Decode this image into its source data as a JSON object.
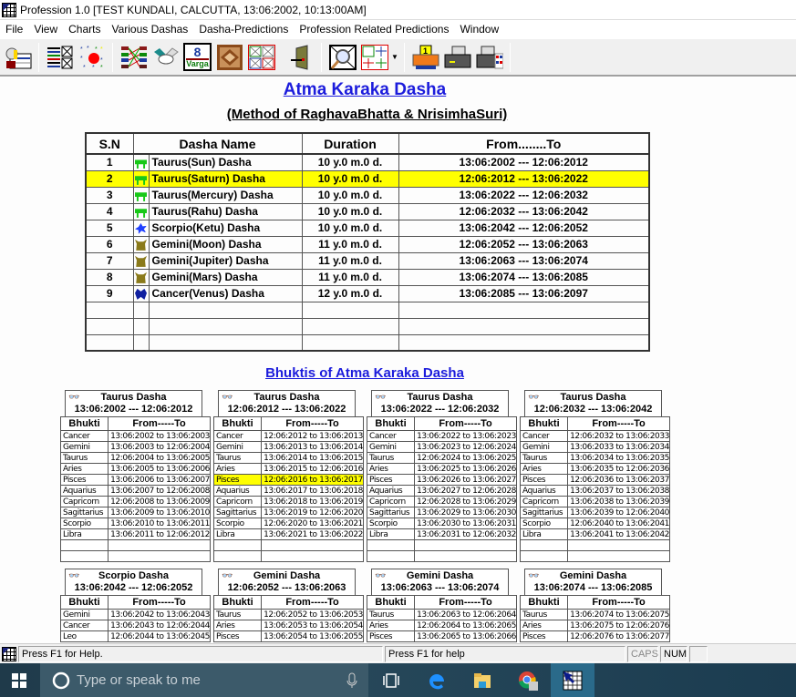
{
  "window": {
    "title": "Profession 1.0 [TEST KUNDALI, CALCUTTA, 13:06:2002, 10:13:00AM]"
  },
  "menu": [
    "File",
    "View",
    "Charts",
    "Various Dashas",
    "Dasha-Predictions",
    "Profession Related Predictions",
    "Window"
  ],
  "toolbar": {
    "buttons": [
      "person-card-icon",
      "chart-list-icon",
      "stars-planet-icon",
      "dasha-lines-icon",
      "handshake-icon",
      "varga-icon",
      "square-chart-icon",
      "four-charts-icon",
      "exit-door-icon",
      "magnify-chart-icon",
      "multi-chart-icon",
      "print-one-icon",
      "printer-icon",
      "color-printer-icon"
    ],
    "varga_number": "8",
    "varga_label": "Varga",
    "print_badge": "1"
  },
  "main": {
    "title": "Atma Karaka Dasha",
    "subtitle": "(Method of RaghavaBhatta & NrisimhaSuri)",
    "columns": [
      "S.N",
      "Dasha Name",
      "Duration",
      "From........To"
    ],
    "rows": [
      {
        "sn": "1",
        "sign": "taurus",
        "name": "Taurus(Sun) Dasha",
        "duration": "10 y.0 m.0 d.",
        "period": "13:06:2002 --- 12:06:2012",
        "highlight": false
      },
      {
        "sn": "2",
        "sign": "taurus",
        "name": "Taurus(Saturn) Dasha",
        "duration": "10 y.0 m.0 d.",
        "period": "12:06:2012 --- 13:06:2022",
        "highlight": true
      },
      {
        "sn": "3",
        "sign": "taurus",
        "name": "Taurus(Mercury) Dasha",
        "duration": "10 y.0 m.0 d.",
        "period": "13:06:2022 --- 12:06:2032",
        "highlight": false
      },
      {
        "sn": "4",
        "sign": "taurus",
        "name": "Taurus(Rahu) Dasha",
        "duration": "10 y.0 m.0 d.",
        "period": "12:06:2032 --- 13:06:2042",
        "highlight": false
      },
      {
        "sn": "5",
        "sign": "scorpio",
        "name": "Scorpio(Ketu) Dasha",
        "duration": "10 y.0 m.0 d.",
        "period": "13:06:2042 --- 12:06:2052",
        "highlight": false
      },
      {
        "sn": "6",
        "sign": "gemini",
        "name": "Gemini(Moon) Dasha",
        "duration": "11 y.0 m.0 d.",
        "period": "12:06:2052 --- 13:06:2063",
        "highlight": false
      },
      {
        "sn": "7",
        "sign": "gemini",
        "name": "Gemini(Jupiter) Dasha",
        "duration": "11 y.0 m.0 d.",
        "period": "13:06:2063 --- 13:06:2074",
        "highlight": false
      },
      {
        "sn": "8",
        "sign": "gemini",
        "name": "Gemini(Mars) Dasha",
        "duration": "11 y.0 m.0 d.",
        "period": "13:06:2074 --- 13:06:2085",
        "highlight": false
      },
      {
        "sn": "9",
        "sign": "cancer",
        "name": "Cancer(Venus) Dasha",
        "duration": "12 y.0 m.0 d.",
        "period": "13:06:2085 --- 13:06:2097",
        "highlight": false
      }
    ],
    "empty_rows": 3
  },
  "bhuktis": {
    "title": "Bhuktis of Atma Karaka Dasha",
    "col_bhukti": "Bhukti",
    "col_period": "From-----To",
    "blocks": [
      {
        "name": "Taurus Dasha",
        "period": "13:06:2002 --- 12:06:2012",
        "rows": [
          [
            "Cancer",
            "13:06:2002 to 13:06:2003"
          ],
          [
            "Gemini",
            "13:06:2003 to 12:06:2004"
          ],
          [
            "Taurus",
            "12:06:2004 to 13:06:2005"
          ],
          [
            "Aries",
            "13:06:2005 to 13:06:2006"
          ],
          [
            "Pisces",
            "13:06:2006 to 13:06:2007"
          ],
          [
            "Aquarius",
            "13:06:2007 to 12:06:2008"
          ],
          [
            "Capricorn",
            "12:06:2008 to 13:06:2009"
          ],
          [
            "Sagittarius",
            "13:06:2009 to 13:06:2010"
          ],
          [
            "Scorpio",
            "13:06:2010 to 13:06:2011"
          ],
          [
            "Libra",
            "13:06:2011 to 12:06:2012"
          ]
        ],
        "highlight": -1
      },
      {
        "name": "Taurus Dasha",
        "period": "12:06:2012 --- 13:06:2022",
        "rows": [
          [
            "Cancer",
            "12:06:2012 to 13:06:2013"
          ],
          [
            "Gemini",
            "13:06:2013 to 13:06:2014"
          ],
          [
            "Taurus",
            "13:06:2014 to 13:06:2015"
          ],
          [
            "Aries",
            "13:06:2015 to 12:06:2016"
          ],
          [
            "Pisces",
            "12:06:2016 to 13:06:2017"
          ],
          [
            "Aquarius",
            "13:06:2017 to 13:06:2018"
          ],
          [
            "Capricorn",
            "13:06:2018 to 13:06:2019"
          ],
          [
            "Sagittarius",
            "13:06:2019 to 12:06:2020"
          ],
          [
            "Scorpio",
            "12:06:2020 to 13:06:2021"
          ],
          [
            "Libra",
            "13:06:2021 to 13:06:2022"
          ]
        ],
        "highlight": 4
      },
      {
        "name": "Taurus Dasha",
        "period": "13:06:2022 --- 12:06:2032",
        "rows": [
          [
            "Cancer",
            "13:06:2022 to 13:06:2023"
          ],
          [
            "Gemini",
            "13:06:2023 to 12:06:2024"
          ],
          [
            "Taurus",
            "12:06:2024 to 13:06:2025"
          ],
          [
            "Aries",
            "13:06:2025 to 13:06:2026"
          ],
          [
            "Pisces",
            "13:06:2026 to 13:06:2027"
          ],
          [
            "Aquarius",
            "13:06:2027 to 12:06:2028"
          ],
          [
            "Capricorn",
            "12:06:2028 to 13:06:2029"
          ],
          [
            "Sagittarius",
            "13:06:2029 to 13:06:2030"
          ],
          [
            "Scorpio",
            "13:06:2030 to 13:06:2031"
          ],
          [
            "Libra",
            "13:06:2031 to 12:06:2032"
          ]
        ],
        "highlight": -1
      },
      {
        "name": "Taurus Dasha",
        "period": "12:06:2032 --- 13:06:2042",
        "rows": [
          [
            "Cancer",
            "12:06:2032 to 13:06:2033"
          ],
          [
            "Gemini",
            "13:06:2033 to 13:06:2034"
          ],
          [
            "Taurus",
            "13:06:2034 to 13:06:2035"
          ],
          [
            "Aries",
            "13:06:2035 to 12:06:2036"
          ],
          [
            "Pisces",
            "12:06:2036 to 13:06:2037"
          ],
          [
            "Aquarius",
            "13:06:2037 to 13:06:2038"
          ],
          [
            "Capricorn",
            "13:06:2038 to 13:06:2039"
          ],
          [
            "Sagittarius",
            "13:06:2039 to 12:06:2040"
          ],
          [
            "Scorpio",
            "12:06:2040 to 13:06:2041"
          ],
          [
            "Libra",
            "13:06:2041 to 13:06:2042"
          ]
        ],
        "highlight": -1
      },
      {
        "name": "Scorpio Dasha",
        "period": "13:06:2042 --- 12:06:2052",
        "rows": [
          [
            "Gemini",
            "13:06:2042 to 13:06:2043"
          ],
          [
            "Cancer",
            "13:06:2043 to 12:06:2044"
          ],
          [
            "Leo",
            "12:06:2044 to 13:06:2045"
          ]
        ],
        "highlight": -1
      },
      {
        "name": "Gemini Dasha",
        "period": "12:06:2052 --- 13:06:2063",
        "rows": [
          [
            "Taurus",
            "12:06:2052 to 13:06:2053"
          ],
          [
            "Aries",
            "13:06:2053 to 13:06:2054"
          ],
          [
            "Pisces",
            "13:06:2054 to 13:06:2055"
          ]
        ],
        "highlight": -1
      },
      {
        "name": "Gemini Dasha",
        "period": "13:06:2063 --- 13:06:2074",
        "rows": [
          [
            "Taurus",
            "13:06:2063 to 12:06:2064"
          ],
          [
            "Aries",
            "12:06:2064 to 13:06:2065"
          ],
          [
            "Pisces",
            "13:06:2065 to 13:06:2066"
          ]
        ],
        "highlight": -1
      },
      {
        "name": "Gemini Dasha",
        "period": "13:06:2074 --- 13:06:2085",
        "rows": [
          [
            "Taurus",
            "13:06:2074 to 13:06:2075"
          ],
          [
            "Aries",
            "13:06:2075 to 12:06:2076"
          ],
          [
            "Pisces",
            "12:06:2076 to 13:06:2077"
          ]
        ],
        "highlight": -1
      }
    ]
  },
  "statusbar": {
    "left": "Press F1 for Help.",
    "middle": "Press F1 for help",
    "caps": "CAPS",
    "num": "NUM"
  },
  "taskbar": {
    "search_placeholder": "Type or speak to me"
  },
  "colors": {
    "highlight": "#ffff00",
    "title_blue": "#1c1cdc"
  }
}
